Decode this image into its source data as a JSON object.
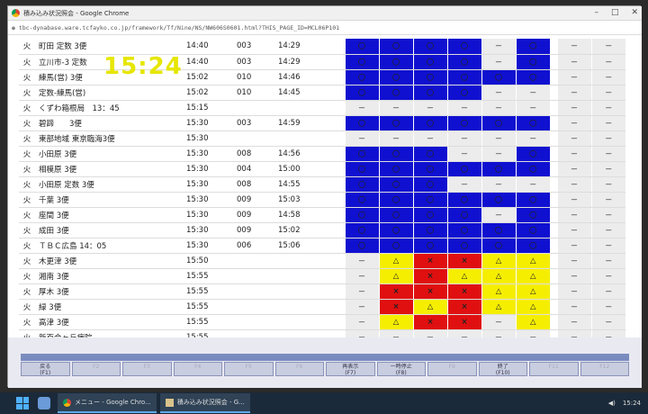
{
  "window": {
    "title": "積み込み状況照会 - Google Chrome",
    "url": "tbc-dynabase.ware.tcfayko.co.jp/framework/Tf/Nine/NS/NW606S0601.html?THIS_PAGE_ID=MCL06P101"
  },
  "clock": "15:24",
  "rows": [
    {
      "day": "火",
      "name": "町田 定数 3便",
      "time": "14:40",
      "code": "003",
      "arr": "14:29",
      "cells": [
        "b",
        "b",
        "b",
        "b",
        "w",
        "b",
        "w",
        "w"
      ]
    },
    {
      "day": "火",
      "name": "立川市-3 定数",
      "time": "14:40",
      "code": "003",
      "arr": "14:29",
      "cells": [
        "b",
        "b",
        "b",
        "b",
        "w",
        "b",
        "w",
        "w"
      ]
    },
    {
      "day": "火",
      "name": "練馬(営) 3便",
      "time": "15:02",
      "code": "010",
      "arr": "14:46",
      "cells": [
        "b",
        "b",
        "b",
        "b",
        "b",
        "b",
        "w",
        "w"
      ]
    },
    {
      "day": "火",
      "name": "定数-練馬(営)",
      "time": "15:02",
      "code": "010",
      "arr": "14:45",
      "cells": [
        "b",
        "b",
        "b",
        "b",
        "w",
        "w",
        "w",
        "w"
      ]
    },
    {
      "day": "火",
      "name": "くずわ箱根局　13：45",
      "time": "15:15",
      "code": "",
      "arr": "",
      "cells": [
        "w",
        "w",
        "w",
        "w",
        "w",
        "w",
        "w",
        "w"
      ]
    },
    {
      "day": "火",
      "name": "碧蹄　　3便",
      "time": "15:30",
      "code": "003",
      "arr": "14:59",
      "cells": [
        "b",
        "b",
        "b",
        "b",
        "b",
        "b",
        "w",
        "w"
      ]
    },
    {
      "day": "火",
      "name": "東部地域 東京臨海3便",
      "time": "15:30",
      "code": "",
      "arr": "",
      "cells": [
        "w",
        "w",
        "w",
        "w",
        "w",
        "w",
        "w",
        "w"
      ]
    },
    {
      "day": "火",
      "name": "小田原 3便",
      "time": "15:30",
      "code": "008",
      "arr": "14:56",
      "cells": [
        "b",
        "b",
        "b",
        "w",
        "w",
        "b",
        "w",
        "w"
      ]
    },
    {
      "day": "火",
      "name": "相模原 3便",
      "time": "15:30",
      "code": "004",
      "arr": "15:00",
      "cells": [
        "b",
        "b",
        "b",
        "b",
        "b",
        "b",
        "w",
        "w"
      ]
    },
    {
      "day": "火",
      "name": "小田原 定数 3便",
      "time": "15:30",
      "code": "008",
      "arr": "14:55",
      "cells": [
        "b",
        "b",
        "b",
        "w",
        "w",
        "w",
        "w",
        "w"
      ]
    },
    {
      "day": "火",
      "name": "千葉 3便",
      "time": "15:30",
      "code": "009",
      "arr": "15:03",
      "cells": [
        "b",
        "b",
        "b",
        "b",
        "b",
        "b",
        "w",
        "w"
      ]
    },
    {
      "day": "火",
      "name": "座間 3便",
      "time": "15:30",
      "code": "009",
      "arr": "14:58",
      "cells": [
        "b",
        "b",
        "b",
        "b",
        "w",
        "b",
        "w",
        "w"
      ]
    },
    {
      "day": "火",
      "name": "成田 3便",
      "time": "15:30",
      "code": "009",
      "arr": "15:02",
      "cells": [
        "b",
        "b",
        "b",
        "b",
        "b",
        "b",
        "w",
        "w"
      ]
    },
    {
      "day": "火",
      "name": "ＴＢＣ広島 14：05",
      "time": "15:30",
      "code": "006",
      "arr": "15:06",
      "cells": [
        "b",
        "b",
        "b",
        "b",
        "b",
        "b",
        "w",
        "w"
      ]
    },
    {
      "day": "火",
      "name": "木更津 3便",
      "time": "15:50",
      "code": "",
      "arr": "",
      "cells": [
        "w",
        "y",
        "r",
        "r",
        "y",
        "y",
        "w",
        "w"
      ]
    },
    {
      "day": "火",
      "name": "湘南 3便",
      "time": "15:55",
      "code": "",
      "arr": "",
      "cells": [
        "w",
        "y",
        "r",
        "y",
        "y",
        "y",
        "w",
        "w"
      ]
    },
    {
      "day": "火",
      "name": "厚木 3便",
      "time": "15:55",
      "code": "",
      "arr": "",
      "cells": [
        "w",
        "r",
        "r",
        "r",
        "y",
        "y",
        "w",
        "w"
      ]
    },
    {
      "day": "火",
      "name": "緑 3便",
      "time": "15:55",
      "code": "",
      "arr": "",
      "cells": [
        "w",
        "r",
        "y",
        "r",
        "y",
        "y",
        "w",
        "w"
      ]
    },
    {
      "day": "火",
      "name": "高津 3便",
      "time": "15:55",
      "code": "",
      "arr": "",
      "cells": [
        "w",
        "y",
        "r",
        "r",
        "w",
        "y",
        "w",
        "w"
      ]
    },
    {
      "day": "火",
      "name": "新百合ヶ丘病院",
      "time": "15:55",
      "code": "",
      "arr": "",
      "cells": [
        "w",
        "w",
        "w",
        "w",
        "w",
        "w",
        "w",
        "w"
      ]
    }
  ],
  "symbols": {
    "b": "〇",
    "y": "△",
    "r": "×",
    "w": "－"
  },
  "colors": {
    "blue": "#1010d0",
    "yellow": "#f5ee00",
    "red": "#e01010",
    "empty": "#ececec",
    "clock": "#e6e600"
  },
  "fkeys": [
    {
      "label": "戻る",
      "key": "(F1)",
      "active": true
    },
    {
      "label": "",
      "key": "F2",
      "active": false
    },
    {
      "label": "",
      "key": "F3",
      "active": false
    },
    {
      "label": "",
      "key": "F4",
      "active": false
    },
    {
      "label": "",
      "key": "F5",
      "active": false
    },
    {
      "label": "",
      "key": "F6",
      "active": false
    },
    {
      "label": "再表示",
      "key": "(F7)",
      "active": true
    },
    {
      "label": "一時停止",
      "key": "(F8)",
      "active": true
    },
    {
      "label": "",
      "key": "F9",
      "active": false
    },
    {
      "label": "終了",
      "key": "(F10)",
      "active": true
    },
    {
      "label": "",
      "key": "F11",
      "active": false
    },
    {
      "label": "",
      "key": "F12",
      "active": false
    }
  ],
  "taskbar": {
    "tasks": [
      "メニュー - Google Chro...",
      "積み込み状況照会 - G..."
    ],
    "time": "15:24"
  }
}
